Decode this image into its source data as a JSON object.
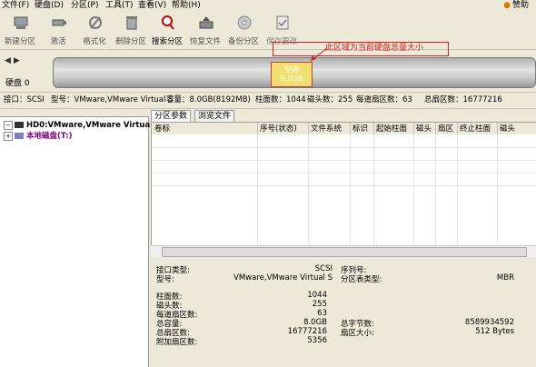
{
  "menu": {
    "items": [
      "文件(F)",
      "硬盘(D)",
      "分区(P)",
      "工具(T)",
      "查看(V)",
      "帮助(H)"
    ],
    "donate": "赞助"
  },
  "toolbar": {
    "buttons": [
      {
        "label": "新建分区",
        "icon": "new-partition-icon"
      },
      {
        "label": "激活",
        "icon": "activate-icon"
      },
      {
        "label": "格式化",
        "icon": "format-icon"
      },
      {
        "label": "删除分区",
        "icon": "delete-partition-icon"
      },
      {
        "label": "搜索分区",
        "icon": "search-partition-icon"
      },
      {
        "label": "恢复文件",
        "icon": "recover-files-icon"
      },
      {
        "label": "备份分区",
        "icon": "backup-partition-icon"
      },
      {
        "label": "保存更改",
        "icon": "save-changes-icon"
      }
    ]
  },
  "disk": {
    "label": "硬盘 0",
    "partition_name": "空闲",
    "partition_size": "8.0GB",
    "annotation": "此区域为当前硬盘总量大小"
  },
  "info": {
    "interface": "接口：SCSI",
    "model": "型号：VMware,VMware Virtual S",
    "capacity": "容量：8.0GB(8192MB)",
    "cylinders": "柱面数：1044",
    "heads": "磁头数：255",
    "sectors_per_track": "每道扇区数：63",
    "total_sectors": "总扇区数：16777216"
  },
  "tree": {
    "disk_node": "HD0:VMware,VMware Virtual",
    "local_disk": "本地磁盘(T:)"
  },
  "tabs": [
    "分区参数",
    "浏览文件"
  ],
  "table": {
    "headers": [
      "卷标",
      "序号(状态)",
      "文件系统",
      "标识",
      "起始柱面",
      "磁头",
      "扇区",
      "终止柱面",
      "磁头"
    ]
  },
  "details": {
    "left": [
      {
        "label": "接口类型:",
        "value": "SCSI"
      },
      {
        "label": "型号:",
        "value": "VMware,VMware Virtual S"
      },
      {
        "label": "柱面数:",
        "value": "1044"
      },
      {
        "label": "磁头数:",
        "value": "255"
      },
      {
        "label": "每道扇区数:",
        "value": "63"
      },
      {
        "label": "总容量:",
        "value": "8.0GB"
      },
      {
        "label": "总扇区数:",
        "value": "16777216"
      },
      {
        "label": "附加扇区数:",
        "value": "5356"
      }
    ],
    "right": [
      {
        "label": "序列号:",
        "value": ""
      },
      {
        "label": "分区表类型:",
        "value": "MBR"
      },
      {
        "label": "总字节数:",
        "value": "8589934592"
      },
      {
        "label": "扇区大小:",
        "value": "512 Bytes"
      }
    ]
  }
}
